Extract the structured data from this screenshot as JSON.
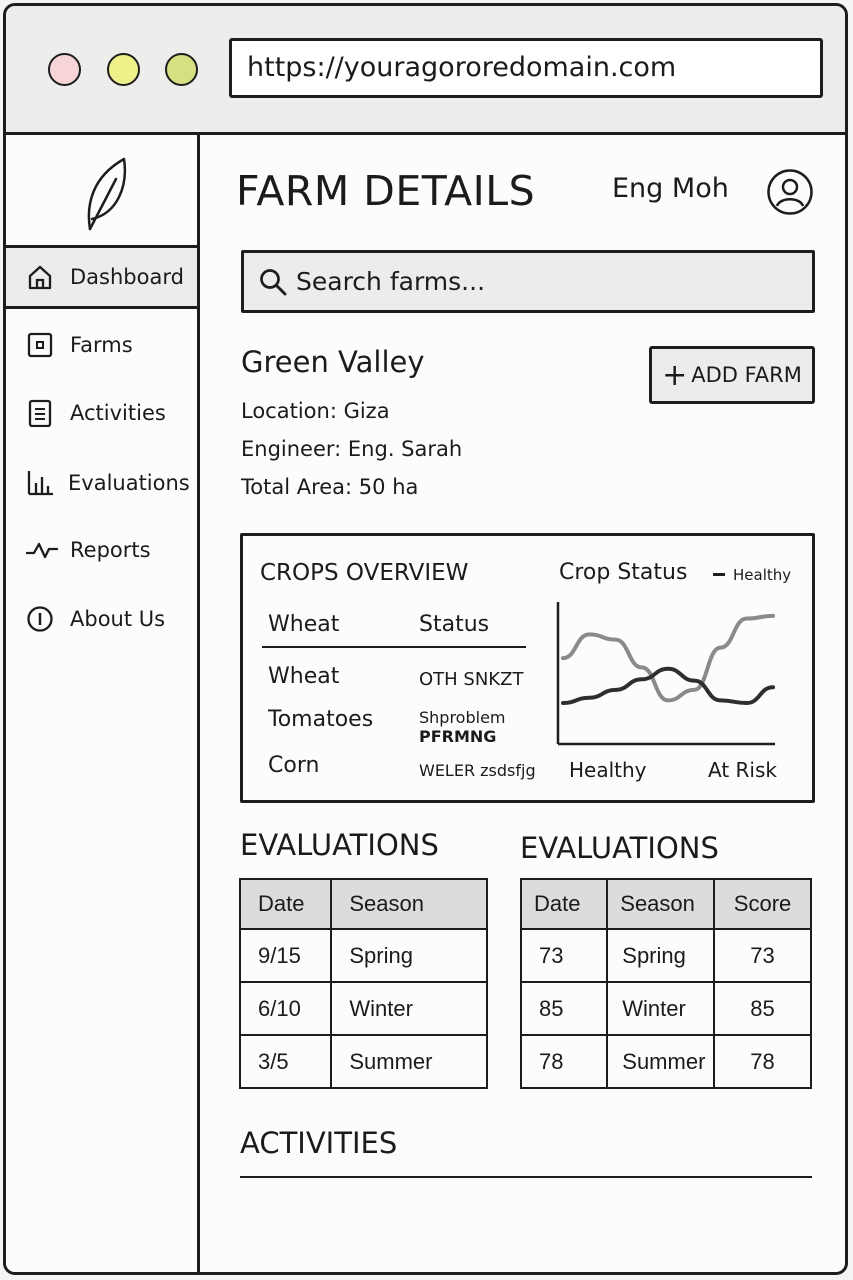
{
  "browser": {
    "url": "https://youragororedomain.com",
    "dots": [
      {
        "name": "close",
        "color": "#f7d4d7"
      },
      {
        "name": "minimize",
        "color": "#eef08a"
      },
      {
        "name": "zoom",
        "color": "#d6e083"
      }
    ]
  },
  "sidebar": {
    "logo_icon": "leaf-icon",
    "items": [
      {
        "label": "Dashboard",
        "icon": "home-icon",
        "active": true
      },
      {
        "label": "Farms",
        "icon": "farm-icon",
        "active": false
      },
      {
        "label": "Activities",
        "icon": "document-icon",
        "active": false
      },
      {
        "label": "Evaluations",
        "icon": "bar-chart-icon",
        "active": false
      },
      {
        "label": "Reports",
        "icon": "pulse-icon",
        "active": false
      },
      {
        "label": "About Us",
        "icon": "info-icon",
        "active": false
      }
    ]
  },
  "header": {
    "title": "FARM DETAILS",
    "user_name": "Eng Moh",
    "avatar_icon": "user-avatar-icon"
  },
  "search": {
    "placeholder": "Search farms...",
    "icon": "search-icon"
  },
  "farm": {
    "name": "Green Valley",
    "location": "Location: Giza",
    "engineer": "Engineer: Eng. Sarah",
    "total_area": "Total Area: 50 ha",
    "add_button": "ADD FARM",
    "add_icon": "plus-icon"
  },
  "crops": {
    "title": "CROPS OVERVIEW",
    "headers": [
      "Wheat",
      "Status"
    ],
    "rows": [
      {
        "name": "Wheat",
        "status_line1": "OTH  SNKZT",
        "status_line2": ""
      },
      {
        "name": "Tomatoes",
        "status_line1": "Shproblem",
        "status_line2": "PFRMNG"
      },
      {
        "name": "Corn",
        "status_line1": "WELER zsdsfjg",
        "status_line2": ""
      }
    ]
  },
  "chart_data": {
    "type": "line",
    "title": "Crop Status",
    "legend": [
      "Healthy"
    ],
    "legend_position": "top-right",
    "x_tick_labels": [
      "Healthy",
      "At Risk"
    ],
    "grid": false,
    "series": [
      {
        "name": "",
        "color": "#8a8a8a",
        "values": [
          0.62,
          0.8,
          0.76,
          0.55,
          0.3,
          0.38,
          0.7,
          0.92,
          0.94
        ]
      },
      {
        "name": "",
        "color": "#2e2e2e",
        "values": [
          0.28,
          0.32,
          0.38,
          0.46,
          0.54,
          0.45,
          0.3,
          0.28,
          0.4
        ]
      }
    ]
  },
  "evaluations_left": {
    "title": "EVALUATIONS",
    "headers": [
      "Date",
      "Season"
    ],
    "rows": [
      [
        "9/15",
        "Spring"
      ],
      [
        "6/10",
        "Winter"
      ],
      [
        "3/5",
        "Summer"
      ]
    ]
  },
  "evaluations_right": {
    "title": "EVALUATIONS",
    "headers": [
      "Date",
      "Season",
      "Score"
    ],
    "rows": [
      [
        "73",
        "Spring",
        "73"
      ],
      [
        "85",
        "Winter",
        "85"
      ],
      [
        "78",
        "Summer",
        "78"
      ]
    ]
  },
  "activities": {
    "title": "ACTIVITIES"
  }
}
